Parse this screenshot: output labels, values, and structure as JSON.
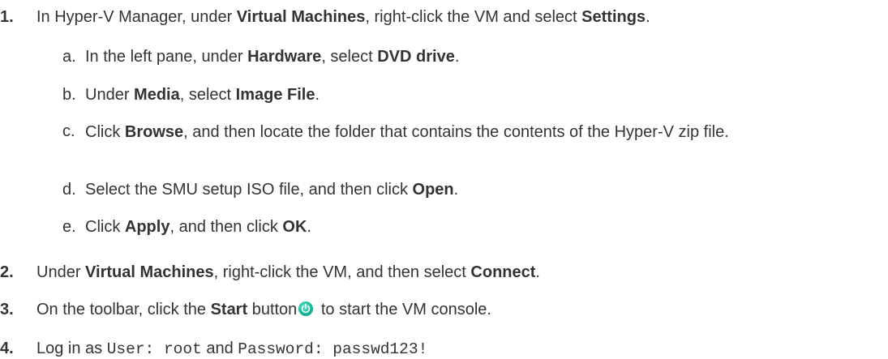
{
  "steps": [
    {
      "num": "1.",
      "parts": [
        "In Hyper-V Manager, under ",
        "Virtual Machines",
        ", right-click the VM and select ",
        "Settings",
        "."
      ],
      "substeps": [
        {
          "letter": "a.",
          "parts": [
            "In the left pane, under ",
            "Hardware",
            ", select ",
            "DVD drive",
            "."
          ]
        },
        {
          "letter": "b.",
          "parts": [
            "Under ",
            "Media",
            ", select ",
            "Image File",
            "."
          ]
        },
        {
          "letter": "c.",
          "parts": [
            "Click ",
            "Browse",
            ", and then locate the folder that contains the contents of the Hyper-V zip file."
          ]
        },
        {
          "letter": "d.",
          "parts": [
            "Select the SMU setup ISO file, and then click ",
            "Open",
            "."
          ]
        },
        {
          "letter": "e.",
          "parts": [
            "Click ",
            "Apply",
            ", and then click ",
            "OK",
            "."
          ]
        }
      ]
    },
    {
      "num": "2.",
      "parts": [
        "Under ",
        "Virtual Machines",
        ", right-click the VM, and then select ",
        "Connect",
        "."
      ]
    },
    {
      "num": "3.",
      "parts": [
        "On the toolbar, click the ",
        "Start",
        " button",
        "to start the VM console."
      ],
      "icon": "power-icon"
    },
    {
      "num": "4.",
      "parts": [
        "Log in as ",
        "User: root",
        " and ",
        "Password: passwd123!"
      ]
    }
  ]
}
